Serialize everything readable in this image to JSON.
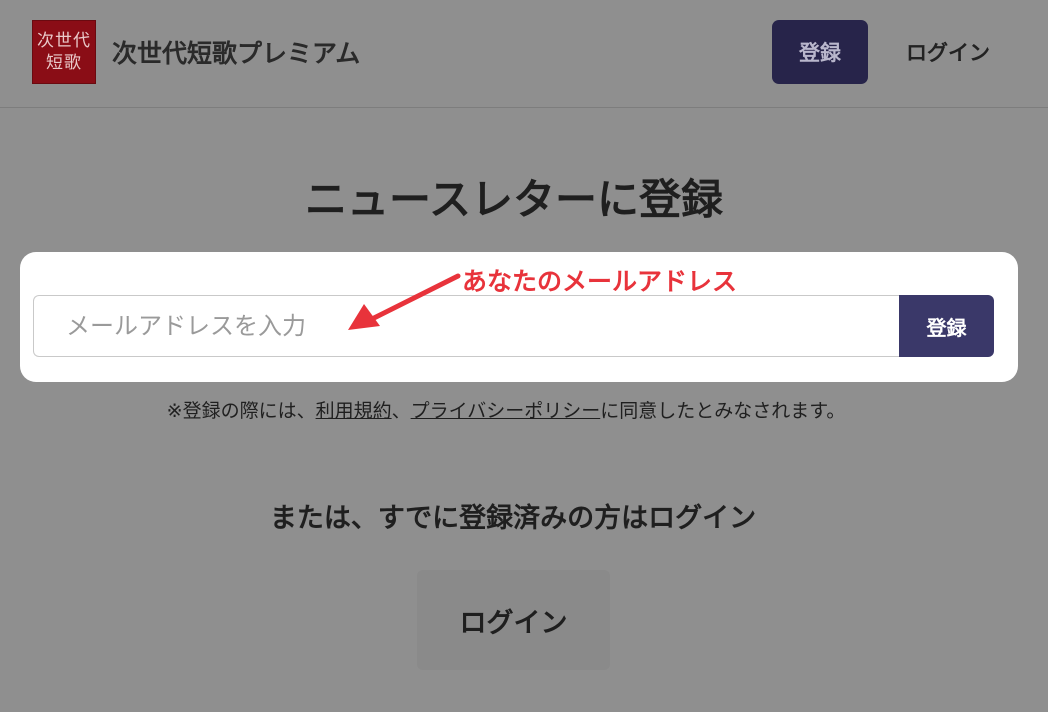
{
  "header": {
    "logo_line1": "次世代",
    "logo_line2": "短歌",
    "site_title": "次世代短歌プレミアム",
    "register_label": "登録",
    "login_label": "ログイン"
  },
  "main": {
    "title": "ニュースレターに登録",
    "email_placeholder": "メールアドレスを入力",
    "submit_label": "登録",
    "annotation": "あなたのメールアドレス",
    "annotation_color": "#e8333b",
    "terms": {
      "prefix": "※登録の際には、",
      "terms_link": "利用規約",
      "separator": "、",
      "privacy_link": "プライバシーポリシー",
      "suffix": "に同意したとみなされます。"
    },
    "or_text": "または、すでに登録済みの方はログイン",
    "login_label": "ログイン"
  },
  "colors": {
    "overlay_background": "#8f8f8f",
    "primary_button": "#3a3869",
    "header_register_button": "#27244a",
    "logo_background": "#8a0d16"
  }
}
